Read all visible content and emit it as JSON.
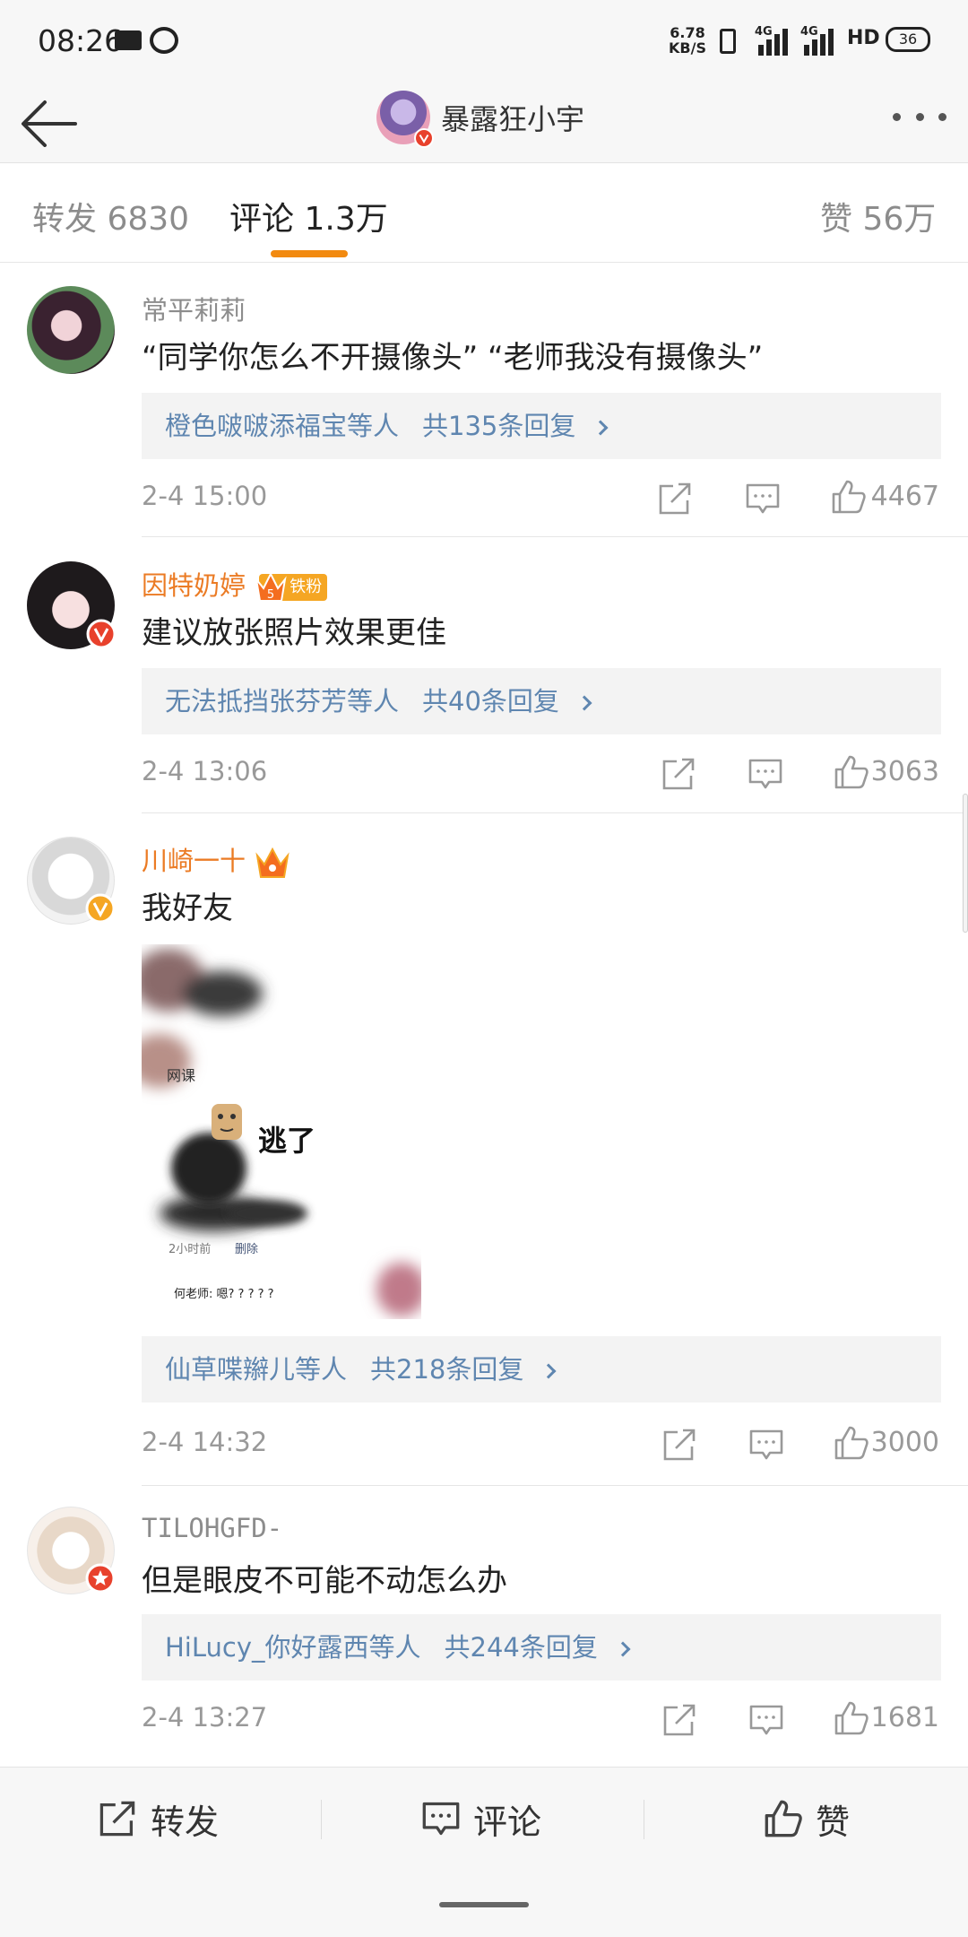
{
  "status_bar": {
    "time": "08:26",
    "net_speed_value": "6.78",
    "net_speed_unit": "KB/S",
    "net1": "4G",
    "net2": "4G",
    "hd": "HD",
    "battery": "36"
  },
  "nav": {
    "title": "暴露狂小宇"
  },
  "tabs": {
    "repost_label": "转发",
    "repost_count": "6830",
    "comment_label": "评论",
    "comment_count": "1.3万",
    "like_label": "赞",
    "like_count": "56万"
  },
  "comments": [
    {
      "name": "常平莉莉",
      "text": "“同学你怎么不开摄像头”  “老师我没有摄像头”",
      "reply_who": "橙色啵啵添福宝等人",
      "reply_count": "共135条回复",
      "time": "2-4 15:00",
      "likes": "4467"
    },
    {
      "name": "因特奶婷",
      "badge": "铁粉",
      "badge_level": "5",
      "text": "建议放张照片效果更佳",
      "reply_who": "无法抵挡张芬芳等人",
      "reply_count": "共40条回复",
      "time": "2-4 13:06",
      "likes": "3063"
    },
    {
      "name": "川崎一十",
      "text": "我好友",
      "image": {
        "course": "网课",
        "caption": "逃了",
        "meta_time": "2小时前",
        "meta_delete": "删除",
        "reply_line": "何老师: 嗯? ? ? ? ?"
      },
      "reply_who": "仙草喋辮儿等人",
      "reply_count": "共218条回复",
      "time": "2-4 14:32",
      "likes": "3000"
    },
    {
      "name": "TILOHGFD-",
      "text": "但是眼皮不可能不动怎么办",
      "reply_who": "HiLucy_你好露西等人",
      "reply_count": "共244条回复",
      "time": "2-4 13:27",
      "likes": "1681"
    }
  ],
  "bottom_bar": {
    "repost": "转发",
    "comment": "评论",
    "like": "赞"
  },
  "colors": {
    "accent_orange": "#f28a10",
    "link_blue": "#5f86b0",
    "vip_name": "#eb7b24"
  },
  "icons": [
    "back-arrow-icon",
    "more-icon",
    "share-icon",
    "comment-icon",
    "like-icon",
    "verified-badge-icon",
    "crown-icon"
  ]
}
